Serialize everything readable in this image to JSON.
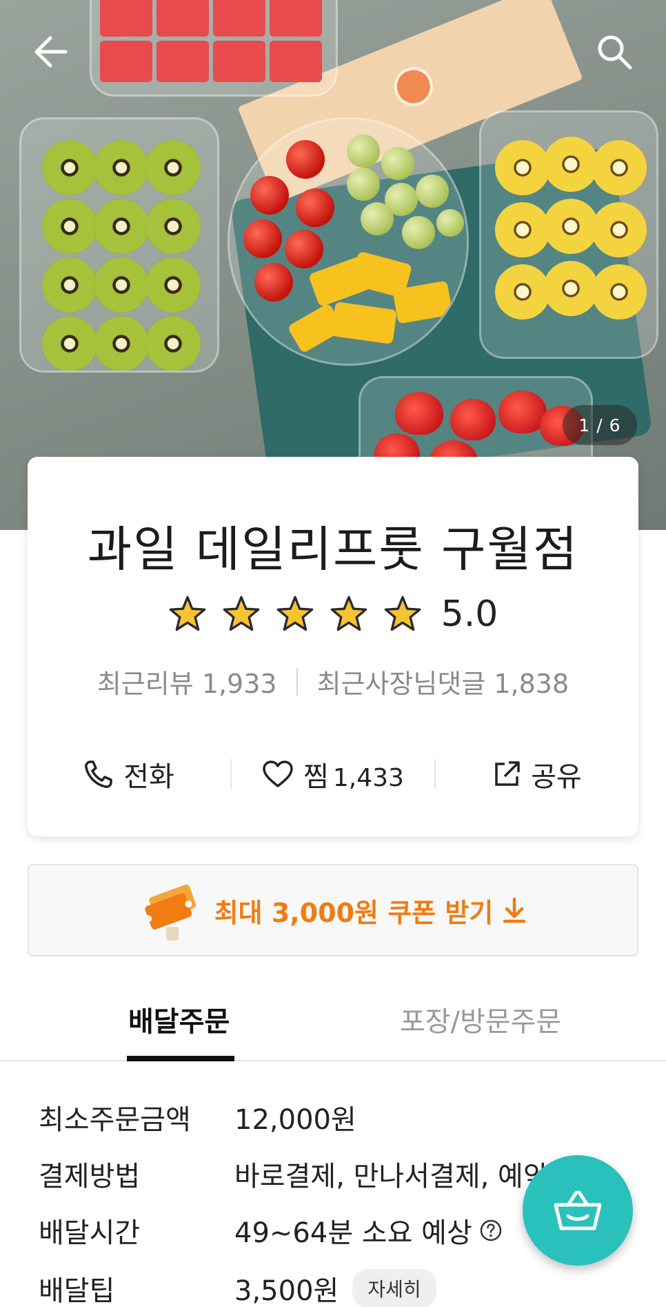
{
  "hero": {
    "page_counter": "1 / 6",
    "icons": {
      "back": "back-arrow-icon",
      "search": "search-icon"
    }
  },
  "store": {
    "name": "과일 데일리프룻 구월점",
    "rating": "5.0",
    "star_count": 5,
    "recent_reviews_label": "최근리뷰 1,933",
    "recent_owner_replies_label": "최근사장님댓글 1,838"
  },
  "actions": {
    "call_label": "전화",
    "favorite_label": "찜",
    "favorite_count": "1,433",
    "share_label": "공유"
  },
  "coupon": {
    "text": "최대 3,000원 쿠폰 받기",
    "color": "#f07c12"
  },
  "tabs": [
    {
      "label": "배달주문",
      "selected": true
    },
    {
      "label": "포장/방문주문",
      "selected": false
    }
  ],
  "info": {
    "min_order_label": "최소주문금액",
    "min_order_value": "12,000원",
    "payment_label": "결제방법",
    "payment_value": "바로결제, 만나서결제, 예약",
    "delivery_time_label": "배달시간",
    "delivery_time_value": "49~64분 소요 예상",
    "delivery_tip_label": "배달팁",
    "delivery_tip_value": "3,500원",
    "detail_button": "자세히"
  },
  "colors": {
    "accent": "#2ac1bc",
    "star": "#f5c431"
  }
}
